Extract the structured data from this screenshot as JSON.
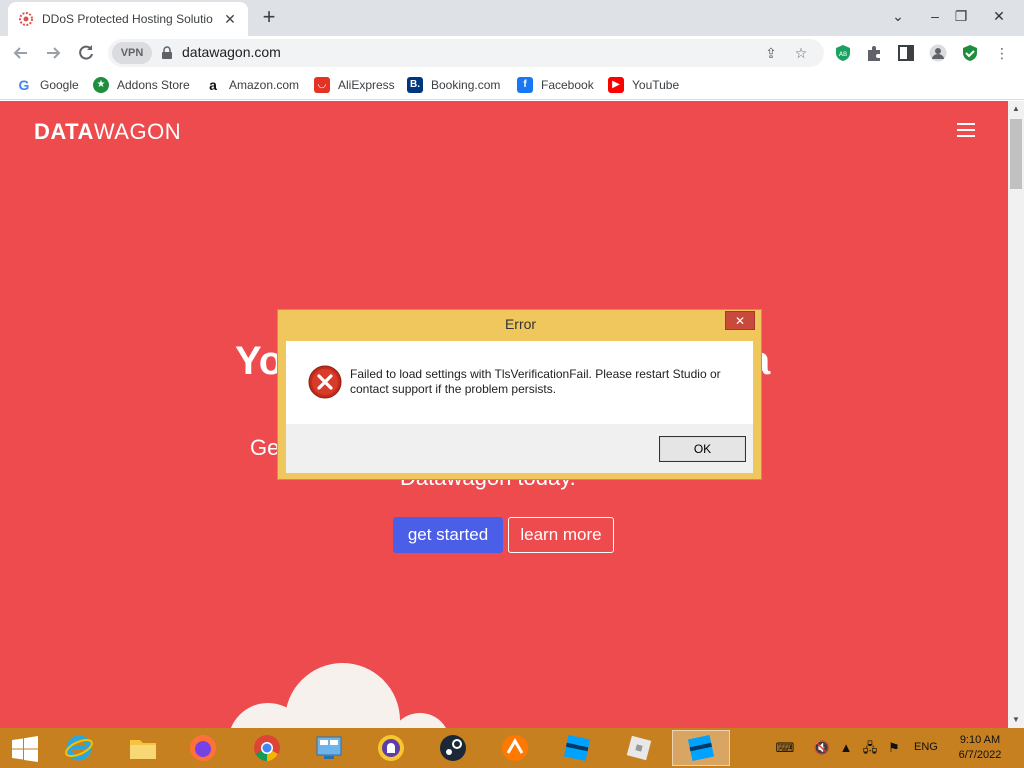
{
  "browser": {
    "tab_title": "DDoS Protected Hosting Solutio",
    "tab_close": "✕",
    "new_tab": "+",
    "minimize": "⌄",
    "min_glyph": "–",
    "restore_glyph": "❐",
    "close_glyph": "✕",
    "vpn": "VPN",
    "url": "datawagon.com",
    "bookmarks": [
      "Google",
      "Addons Store",
      "Amazon.com",
      "AliExpress",
      "Booking.com",
      "Facebook",
      "YouTube"
    ]
  },
  "page": {
    "logo_bold": "DATA",
    "logo_light": "WAGON",
    "hero_title_start": "Yo",
    "hero_title_end": "a",
    "hero_sub_start": "Ge",
    "hero_sub_line2": "Datawagon today.",
    "get_started": "get started",
    "learn_more": "learn more"
  },
  "dialog": {
    "title": "Error",
    "close": "✕",
    "message": "Failed to load settings with TlsVerificationFail. Please restart Studio or contact support if the problem persists.",
    "ok": "OK"
  },
  "taskbar": {
    "language": "ENG",
    "time": "9:10 AM",
    "date": "6/7/2022"
  },
  "colors": {
    "page_bg": "#ed4b4e",
    "primary_button": "#4a5ee8",
    "taskbar": "#c7801f",
    "dialog_frame": "#f0c75d"
  }
}
